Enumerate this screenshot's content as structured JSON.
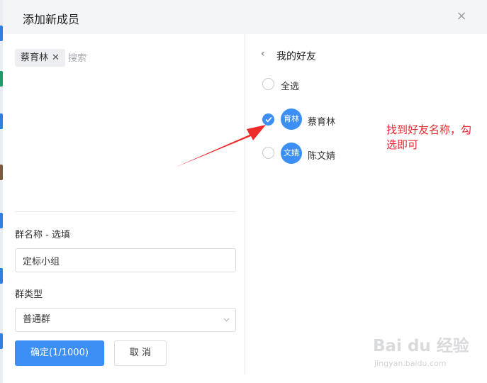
{
  "dialog": {
    "title": "添加新成员",
    "close_glyph": "×"
  },
  "left": {
    "selected_tag": "蔡育林",
    "tag_remove_glyph": "✕",
    "search_placeholder": "搜索",
    "group_name_label": "群名称 - 选填",
    "group_name_value": "定标小组",
    "group_type_label": "群类型",
    "group_type_value": "普通群",
    "confirm_label": "确定(1/1000)",
    "cancel_label": "取 消"
  },
  "right": {
    "title": "我的好友",
    "back_glyph": "‹",
    "select_all": "全选",
    "friends": [
      {
        "avatar_text": "育林",
        "name": "蔡育林",
        "checked": true
      },
      {
        "avatar_text": "文婧",
        "name": "陈文婧",
        "checked": false
      }
    ]
  },
  "annotation": {
    "text": "找到好友名称，勾选即可"
  },
  "watermark": {
    "logo": "Bai du 经验",
    "sub": "jingyan.baidu.com"
  },
  "colors": {
    "accent": "#3b8ff5",
    "annotation": "#e8262d",
    "header_bg": "#f4f5f7"
  },
  "icons": {
    "close": "close-icon",
    "back": "chevron-left-icon",
    "check": "check-icon",
    "chevron_down": "chevron-down-icon"
  }
}
